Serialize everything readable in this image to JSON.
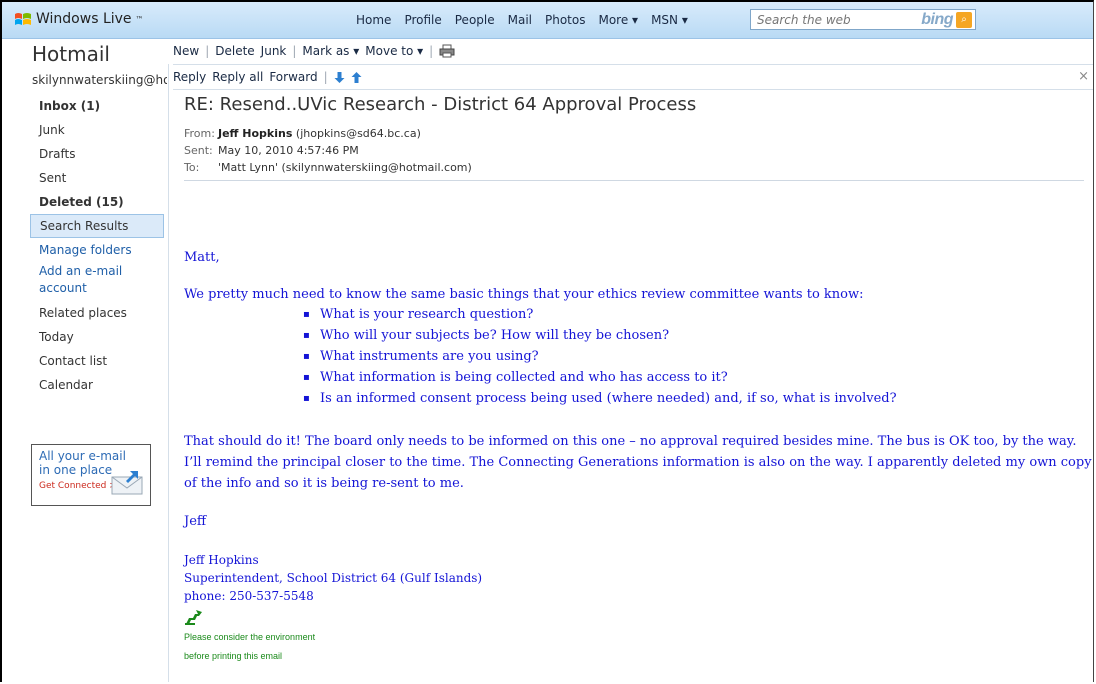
{
  "header": {
    "brand": "Windows Live",
    "brand_tm": "™",
    "nav": [
      "Home",
      "Profile",
      "People",
      "Mail",
      "Photos",
      "More ▾",
      "MSN ▾"
    ],
    "search_placeholder": "Search the web",
    "search_engine": "bing"
  },
  "sidebar": {
    "title": "Hotmail",
    "account": "skilynnwaterskiing@hot",
    "folders": [
      {
        "label": "Inbox (1)"
      },
      {
        "label": "Junk"
      },
      {
        "label": "Drafts"
      },
      {
        "label": "Sent"
      },
      {
        "label": "Deleted (15)"
      },
      {
        "label": "Search Results"
      }
    ],
    "manage_folders": "Manage folders",
    "add_account_1": "Add an e-mail",
    "add_account_2": "account",
    "related_places": "Related places",
    "related": [
      "Today",
      "Contact list",
      "Calendar"
    ],
    "ad": {
      "line1": "All your e-mail",
      "line2": "in one place",
      "line3": "Get Connected >"
    }
  },
  "toolbar": {
    "new": "New",
    "delete": "Delete",
    "junk": "Junk",
    "mark_as": "Mark as ▾",
    "move_to": "Move to ▾"
  },
  "msg_toolbar": {
    "reply": "Reply",
    "reply_all": "Reply all",
    "forward": "Forward",
    "close": "×"
  },
  "message": {
    "subject": "RE: Resend..UVic Research - District 64 Approval Process",
    "from_label": "From:",
    "from_name": "Jeff Hopkins",
    "from_email": "(jhopkins@sd64.bc.ca)",
    "sent_label": "Sent:",
    "sent": "May 10, 2010 4:57:46 PM",
    "to_label": "To:",
    "to": "'Matt Lynn' (skilynnwaterskiing@hotmail.com)",
    "greeting": "Matt,",
    "intro": "We pretty much need to know the same basic things that your ethics review committee wants to know:",
    "bullets": [
      "What is your research question?",
      "Who will your subjects be? How will they be chosen?",
      "What instruments are you using?",
      "What information is being collected and who has access to it?",
      "Is an informed consent process being used (where needed) and, if so, what is involved?"
    ],
    "paragraph": "That should do it! The board only needs to be informed on this one – no approval required besides mine. The bus is OK too, by the way. I’ll remind the principal closer to the time. The Connecting Generations information is also on the way. I apparently deleted my own copy of the info and so it is being re-sent to me.",
    "signoff": "Jeff",
    "sig_name": "Jeff Hopkins",
    "sig_title": "Superintendent, School District 64 (Gulf Islands)",
    "sig_phone": "phone: 250-537-5548",
    "env_line1": "Please consider the environment",
    "env_line2": "before printing this email"
  },
  "colors": {
    "header_bg": "#c6e1f7",
    "link": "#1f5fa8",
    "body_text": "#1414d6",
    "env_green": "#1b8a1b"
  }
}
